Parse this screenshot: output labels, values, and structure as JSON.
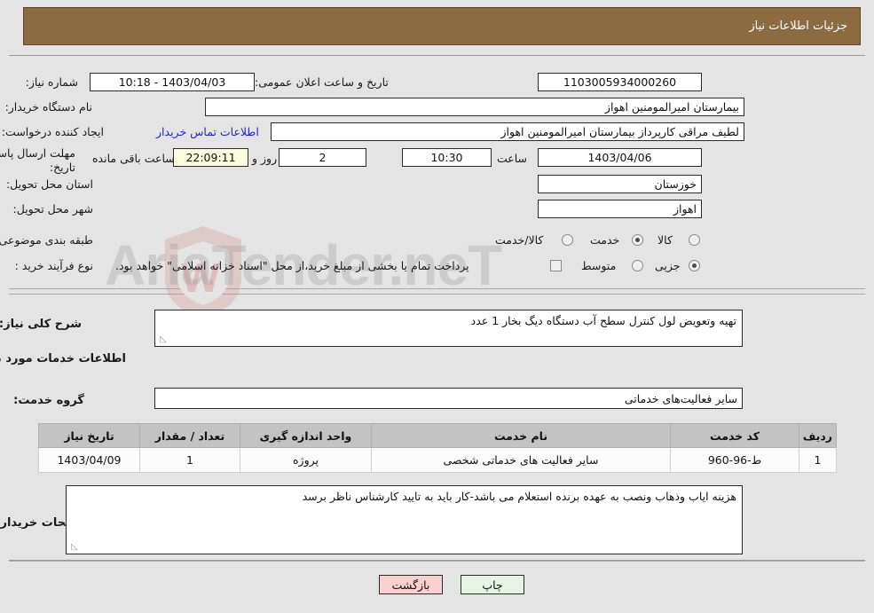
{
  "header": {
    "title": "جزئیات اطلاعات نیاز"
  },
  "watermark": {
    "text": "AriaTender.neT",
    "mark": "W"
  },
  "top_form": {
    "need_number": {
      "label": "شماره نیاز:",
      "value": "1103005934000260"
    },
    "announce_datetime": {
      "label": "تاریخ و ساعت اعلان عمومی:",
      "value": "1403/04/03 - 10:18"
    },
    "buyer_org": {
      "label": "نام دستگاه خریدار:",
      "value": "بیمارستان امیرالمومنین اهواز"
    },
    "request_creator": {
      "label": "ایجاد کننده درخواست:",
      "value": "لطیف مراقی کارپرداز بیمارستان امیرالمومنین اهواز"
    },
    "buyer_contact_link": "اطلاعات تماس خریدار",
    "deadline": {
      "label": "مهلت ارسال پاسخ: تا تاریخ:",
      "date": "1403/04/06",
      "time_label": "ساعت",
      "time": "10:30",
      "days": "2",
      "days_label": "روز و",
      "countdown": "22:09:11",
      "countdown_label": "ساعت باقی مانده"
    },
    "province": {
      "label": "استان محل تحویل:",
      "value": "خوزستان"
    },
    "city": {
      "label": "شهر محل تحویل:",
      "value": "اهواز"
    },
    "category": {
      "label": "طبقه بندی موضوعی:",
      "options": [
        "کالا",
        "خدمت",
        "کالا/خدمت"
      ],
      "selected": "خدمت"
    },
    "purchase_type": {
      "label": "نوع فرآیند خرید :",
      "options": [
        "جزیی",
        "متوسط"
      ],
      "selected": "جزیی"
    },
    "treasury_note": {
      "checked": false,
      "text": "پرداخت تمام یا بخشی از مبلغ خرید،از محل \"اسناد خزانه اسلامی\" خواهد بود."
    }
  },
  "description": {
    "label": "شرح کلی نیاز:",
    "value": "تهیه وتعویض لول کنترل سطح آب دستگاه دیگ بخار  1 عدد"
  },
  "services_section": {
    "heading": "اطلاعات خدمات مورد نیاز",
    "service_group": {
      "label": "گروه خدمت:",
      "value": "سایر فعالیت‌های خدماتی"
    },
    "table": {
      "columns": [
        "ردیف",
        "کد خدمت",
        "نام خدمت",
        "واحد اندازه گیری",
        "تعداد / مقدار",
        "تاریخ نیاز"
      ],
      "rows": [
        {
          "row": "1",
          "service_code": "ط-96-960",
          "service_name": "سایر فعالیت های خدماتی شخصی",
          "unit": "پروژه",
          "quantity": "1",
          "need_date": "1403/04/09"
        }
      ]
    }
  },
  "buyer_notes": {
    "label": "توضیحات خریدار:",
    "value": "هزینه ایاب وذهاب ونصب به عهده برنده استعلام می باشد-کار باید به تایید کارشناس ناظر برسد"
  },
  "footer": {
    "print_label": "چاپ",
    "back_label": "بازگشت"
  }
}
